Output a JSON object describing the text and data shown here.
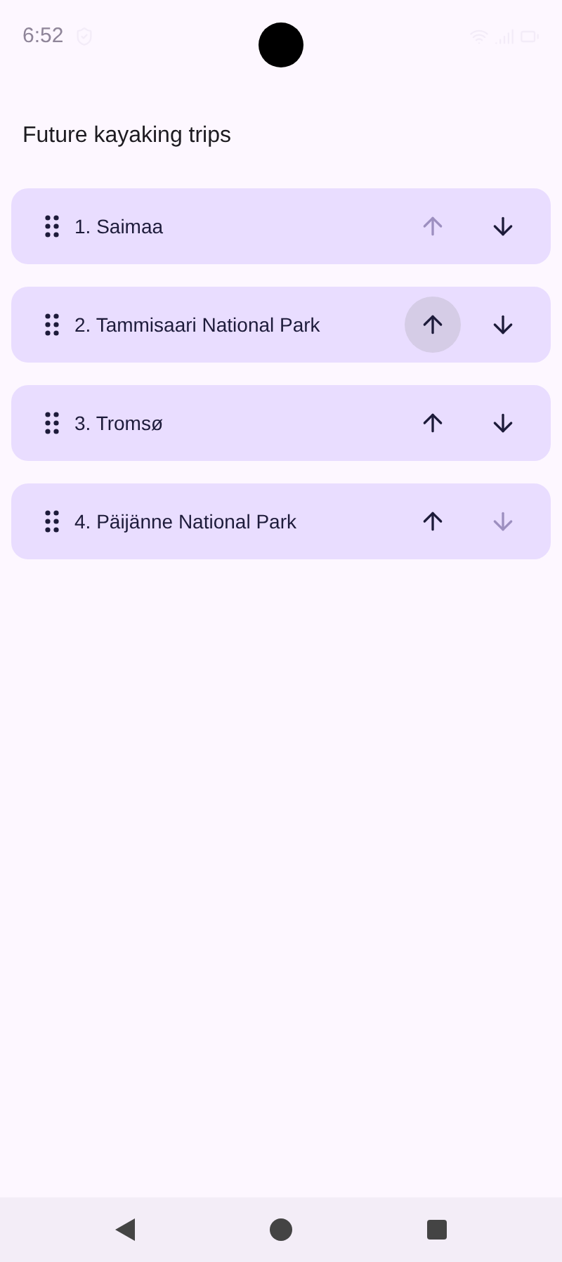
{
  "status_bar": {
    "time": "6:52"
  },
  "title": "Future kayaking trips",
  "trips": [
    {
      "label": "1. Saimaa",
      "up_disabled": true,
      "down_disabled": false,
      "up_pressed": false
    },
    {
      "label": "2. Tammisaari National Park",
      "up_disabled": false,
      "down_disabled": false,
      "up_pressed": true
    },
    {
      "label": "3. Tromsø",
      "up_disabled": false,
      "down_disabled": false,
      "up_pressed": false
    },
    {
      "label": "4. Päijänne National Park",
      "up_disabled": false,
      "down_disabled": true,
      "up_pressed": false
    }
  ]
}
